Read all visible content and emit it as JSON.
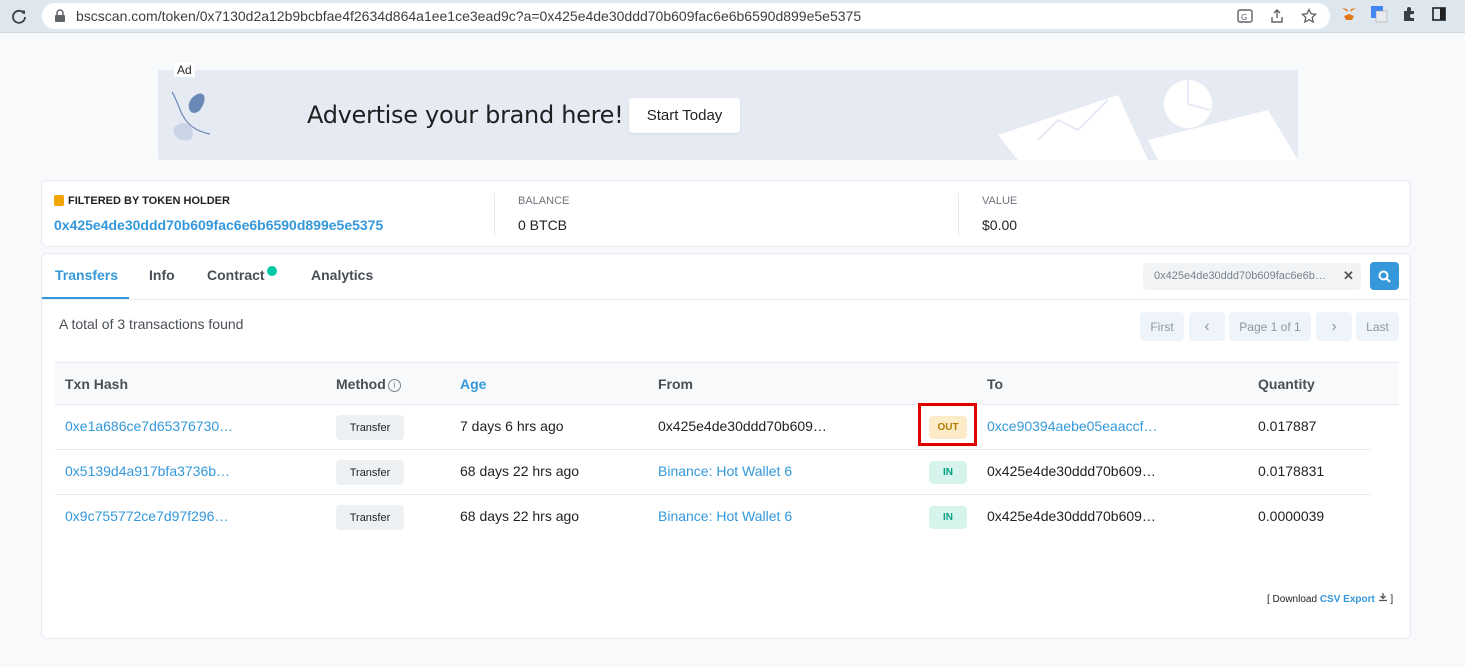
{
  "browser": {
    "url": "bscscan.com/token/0x7130d2a12b9bcbfae4f2634d864a1ee1ce3ead9c?a=0x425e4de30ddd70b609fac6e6b6590d899e5e5375"
  },
  "ad": {
    "badge": "Ad",
    "headline": "Advertise your brand here!",
    "button": "Start Today"
  },
  "holder": {
    "filtered_label": "FILTERED BY TOKEN HOLDER",
    "address": "0x425e4de30ddd70b609fac6e6b6590d899e5e5375",
    "balance_label": "BALANCE",
    "balance_value": "0 BTCB",
    "value_label": "VALUE",
    "value_value": "$0.00"
  },
  "tabs": [
    {
      "label": "Transfers"
    },
    {
      "label": "Info"
    },
    {
      "label": "Contract"
    },
    {
      "label": "Analytics"
    }
  ],
  "search": {
    "value": "0x425e4de30ddd70b609fac6e6b6590d899e5e5375"
  },
  "summary": "A total of 3 transactions found",
  "pager": {
    "first": "First",
    "prev": "‹",
    "page": "Page 1 of 1",
    "next": "›",
    "last": "Last"
  },
  "table": {
    "headers": {
      "hash": "Txn Hash",
      "method": "Method",
      "age": "Age",
      "from": "From",
      "to": "To",
      "quantity": "Quantity"
    },
    "rows": [
      {
        "hash": "0xe1a686ce7d65376730…",
        "method": "Transfer",
        "age": "7 days 6 hrs ago",
        "from": "0x425e4de30ddd70b609…",
        "dir": "OUT",
        "to": "0xce90394aebe05eaaccf…",
        "quantity": "0.017887"
      },
      {
        "hash": "0x5139d4a917bfa3736b…",
        "method": "Transfer",
        "age": "68 days 22 hrs ago",
        "from": "Binance: Hot Wallet 6",
        "dir": "IN",
        "to": "0x425e4de30ddd70b609…",
        "quantity": "0.0178831"
      },
      {
        "hash": "0x9c755772ce7d97f296…",
        "method": "Transfer",
        "age": "68 days 22 hrs ago",
        "from": "Binance: Hot Wallet 6",
        "dir": "IN",
        "to": "0x425e4de30ddd70b609…",
        "quantity": "0.0000039"
      }
    ]
  },
  "export": {
    "prefix": "[ Download",
    "link": "CSV Export",
    "suffix": "]"
  },
  "colors": {
    "accent": "#3498db",
    "out_badge": "#fcebc8",
    "in_badge": "#d7f4ec",
    "highlight": "#e00000"
  }
}
